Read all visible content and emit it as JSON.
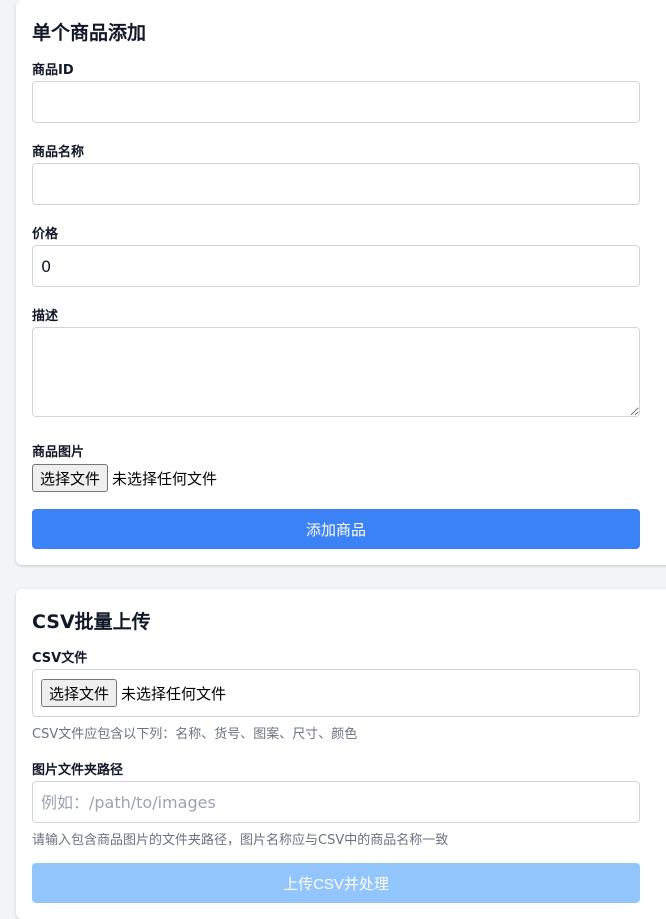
{
  "single_product": {
    "title": "单个商品添加",
    "product_id_label": "商品ID",
    "product_id_value": "",
    "product_name_label": "商品名称",
    "product_name_value": "",
    "price_label": "价格",
    "price_value": "0",
    "description_label": "描述",
    "description_value": "",
    "image_label": "商品图片",
    "file_button_label": "选择文件",
    "file_status": "未选择任何文件",
    "submit_label": "添加商品"
  },
  "csv_upload": {
    "title": "CSV批量上传",
    "csv_file_label": "CSV文件",
    "file_button_label": "选择文件",
    "file_status": "未选择任何文件",
    "csv_hint": "CSV文件应包含以下列：名称、货号、图案、尺寸、颜色",
    "image_folder_label": "图片文件夹路径",
    "image_folder_value": "",
    "image_folder_placeholder": "例如：/path/to/images",
    "image_folder_hint": "请输入包含商品图片的文件夹路径，图片名称应与CSV中的商品名称一致",
    "submit_label": "上传CSV并处理"
  },
  "colors": {
    "primary": "#3b82f6",
    "primary_disabled": "#93c5fd",
    "hint_text": "#6b7280",
    "input_border": "#d1d5db"
  }
}
